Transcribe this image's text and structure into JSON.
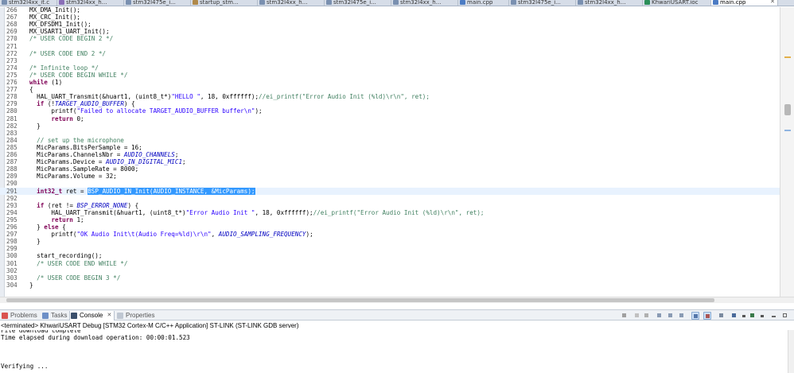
{
  "editor_tabs": [
    {
      "label": "stm32l4xx_it.c",
      "icon": "c-file-icon",
      "type": "c"
    },
    {
      "label": "stm32l4xx_h...",
      "icon": "header-file-icon",
      "type": "h"
    },
    {
      "label": "stm32l475e_i...",
      "icon": "c-file-icon",
      "type": "c"
    },
    {
      "label": "startup_stm...",
      "icon": "asm-file-icon",
      "type": "s"
    },
    {
      "label": "stm32l4xx_h...",
      "icon": "c-file-icon",
      "type": "c"
    },
    {
      "label": "stm32l475e_i...",
      "icon": "c-file-icon",
      "type": "c"
    },
    {
      "label": "stm32l4xx_h...",
      "icon": "c-file-icon",
      "type": "c"
    },
    {
      "label": "main.cpp",
      "icon": "cpp-file-icon",
      "type": "cpp"
    },
    {
      "label": "stm32l475e_i...",
      "icon": "c-file-icon",
      "type": "c"
    },
    {
      "label": "stm32l4xx_h...",
      "icon": "c-file-icon",
      "type": "c"
    },
    {
      "label": "KhwariUSART.ioc",
      "icon": "ioc-file-icon",
      "type": "ioc"
    },
    {
      "label": "main.cpp",
      "icon": "cpp-file-icon",
      "type": "cpp",
      "active": true
    }
  ],
  "code_lines": [
    {
      "n": "266",
      "t": "MX_DMA_Init();"
    },
    {
      "n": "267",
      "t": "MX_CRC_Init();"
    },
    {
      "n": "268",
      "t": "MX_DFSDM1_Init();"
    },
    {
      "n": "269",
      "t": "MX_USART1_UART_Init();"
    },
    {
      "n": "270",
      "t": "/* USER CODE BEGIN 2 */"
    },
    {
      "n": "271",
      "t": ""
    },
    {
      "n": "272",
      "t": "/* USER CODE END 2 */"
    },
    {
      "n": "273",
      "t": ""
    },
    {
      "n": "274",
      "t": "/* Infinite loop */"
    },
    {
      "n": "275",
      "t": "/* USER CODE BEGIN WHILE */"
    },
    {
      "n": "276",
      "t": "while (1)"
    },
    {
      "n": "277",
      "t": "{"
    },
    {
      "n": "278",
      "t": "  HAL_UART_Transmit(&huart1, (uint8_t*)\"HELLO \", 18, 0xffffff);//ei_printf(\"Error Audio Init (%ld)\\r\\n\", ret);"
    },
    {
      "n": "279",
      "t": "  if (!TARGET_AUDIO_BUFFER) {"
    },
    {
      "n": "280",
      "t": "      printf(\"Failed to allocate TARGET_AUDIO_BUFFER buffer\\n\");"
    },
    {
      "n": "281",
      "t": "      return 0;"
    },
    {
      "n": "282",
      "t": "  }"
    },
    {
      "n": "283",
      "t": ""
    },
    {
      "n": "284",
      "t": "  // set up the microphone"
    },
    {
      "n": "285",
      "t": "  MicParams.BitsPerSample = 16;"
    },
    {
      "n": "286",
      "t": "  MicParams.ChannelsNbr = AUDIO_CHANNELS;"
    },
    {
      "n": "287",
      "t": "  MicParams.Device = AUDIO_IN_DIGITAL_MIC1;"
    },
    {
      "n": "288",
      "t": "  MicParams.SampleRate = 8000;"
    },
    {
      "n": "289",
      "t": "  MicParams.Volume = 32;"
    },
    {
      "n": "290",
      "t": ""
    },
    {
      "n": "291",
      "t": "  int32_t ret = BSP_AUDIO_IN_Init(AUDIO_INSTANCE, &MicParams);"
    },
    {
      "n": "292",
      "t": ""
    },
    {
      "n": "293",
      "t": "  if (ret != BSP_ERROR_NONE) {"
    },
    {
      "n": "294",
      "t": "      HAL_UART_Transmit(&huart1, (uint8_t*)\"Error Audio Init \", 18, 0xffffff);//ei_printf(\"Error Audio Init (%ld)\\r\\n\", ret);"
    },
    {
      "n": "295",
      "t": "      return 1;"
    },
    {
      "n": "296",
      "t": "  } else {"
    },
    {
      "n": "297",
      "t": "      printf(\"OK Audio Init\\t(Audio Freq=%ld)\\r\\n\", AUDIO_SAMPLING_FREQUENCY);"
    },
    {
      "n": "298",
      "t": "  }"
    },
    {
      "n": "299",
      "t": ""
    },
    {
      "n": "300",
      "t": "  start_recording();"
    },
    {
      "n": "301",
      "t": "  /* USER CODE END WHILE */"
    },
    {
      "n": "302",
      "t": ""
    },
    {
      "n": "303",
      "t": "  /* USER CODE BEGIN 3 */"
    },
    {
      "n": "304",
      "t": "}"
    }
  ],
  "selection": {
    "line": "291",
    "text": "BSP_AUDIO_IN_Init(AUDIO_INSTANCE, &MicParams);"
  },
  "panel_tabs": [
    {
      "label": "Problems",
      "icon": "problems-icon"
    },
    {
      "label": "Tasks",
      "icon": "tasks-icon"
    },
    {
      "label": "Console",
      "icon": "console-icon",
      "active": true
    },
    {
      "label": "Properties",
      "icon": "properties-icon"
    }
  ],
  "console": {
    "status": "<terminated> KhwariUSART Debug [STM32 Cortex-M C/C++ Application] ST-LINK (ST-LINK GDB server)",
    "lines": [
      "File download complete",
      "Time elapsed during download operation: 00:00:01.523",
      "",
      "",
      "",
      "Verifying ..."
    ]
  },
  "colors": {
    "keyword": "#7f0055",
    "comment": "#3f7f5f",
    "string": "#2a00ff",
    "macro": "#0000c0",
    "selection": "#3399ff",
    "current_line": "#e8f2fe"
  }
}
